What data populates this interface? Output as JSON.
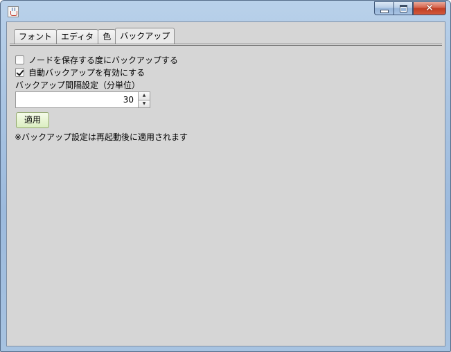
{
  "tabs": [
    "フォント",
    "エディタ",
    "色",
    "バックアップ"
  ],
  "active_tab": 3,
  "backup": {
    "save_on_node_label": "ノードを保存する度にバックアップする",
    "save_on_node_checked": false,
    "auto_backup_label": "自動バックアップを有効にする",
    "auto_backup_checked": true,
    "interval_label": "バックアップ間隔設定（分単位）",
    "interval_value": "30",
    "apply_label": "適用",
    "note": "※バックアップ設定は再起動後に適用されます"
  },
  "icons": {
    "app": "java-icon",
    "minimize": "minimize-icon",
    "maximize": "maximize-icon",
    "close": "close-icon",
    "spin_up": "arrow-up-icon",
    "spin_down": "arrow-down-icon"
  }
}
